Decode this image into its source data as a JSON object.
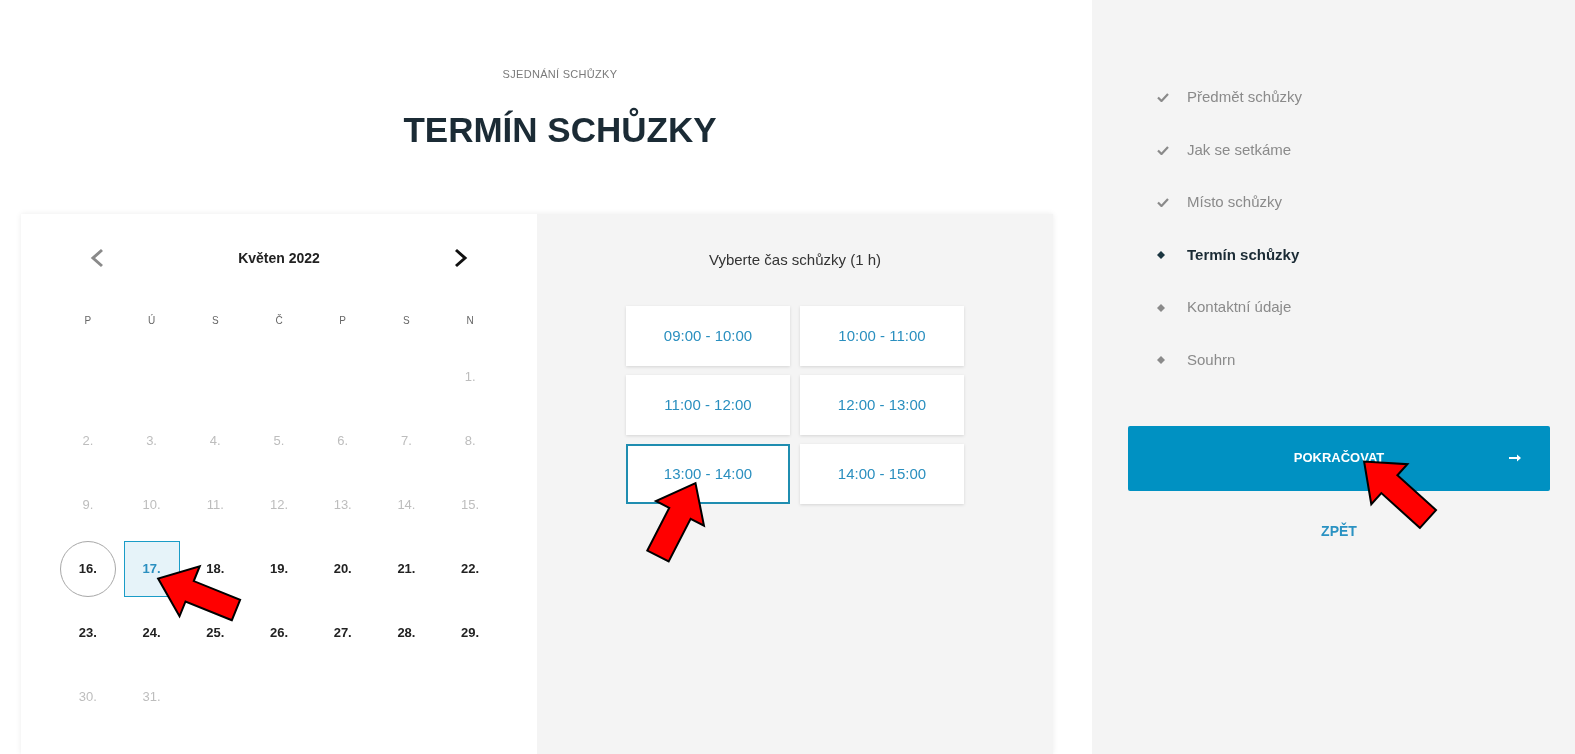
{
  "header": {
    "eyebrow": "SJEDNÁNÍ SCHŮZKY",
    "title": "TERMÍN SCHŮZKY"
  },
  "calendar": {
    "month": "Květen 2022",
    "prev": {
      "disabled": true
    },
    "next": {
      "disabled": false
    },
    "weekdays": [
      "P",
      "Ú",
      "S",
      "Č",
      "P",
      "S",
      "N"
    ],
    "weeks": [
      [
        {
          "label": "1.",
          "disabled": true,
          "today": false,
          "selected": false
        }
      ],
      [
        {
          "label": "2.",
          "disabled": true,
          "today": false,
          "selected": false
        },
        {
          "label": "3.",
          "disabled": true,
          "today": false,
          "selected": false
        },
        {
          "label": "4.",
          "disabled": true,
          "today": false,
          "selected": false
        },
        {
          "label": "5.",
          "disabled": true,
          "today": false,
          "selected": false
        },
        {
          "label": "6.",
          "disabled": true,
          "today": false,
          "selected": false
        },
        {
          "label": "7.",
          "disabled": true,
          "today": false,
          "selected": false
        },
        {
          "label": "8.",
          "disabled": true,
          "today": false,
          "selected": false
        }
      ],
      [
        {
          "label": "9.",
          "disabled": true,
          "today": false,
          "selected": false
        },
        {
          "label": "10.",
          "disabled": true,
          "today": false,
          "selected": false
        },
        {
          "label": "11.",
          "disabled": true,
          "today": false,
          "selected": false
        },
        {
          "label": "12.",
          "disabled": true,
          "today": false,
          "selected": false
        },
        {
          "label": "13.",
          "disabled": true,
          "today": false,
          "selected": false
        },
        {
          "label": "14.",
          "disabled": true,
          "today": false,
          "selected": false
        },
        {
          "label": "15.",
          "disabled": true,
          "today": false,
          "selected": false
        }
      ],
      [
        {
          "label": "16.",
          "disabled": false,
          "today": true,
          "selected": false
        },
        {
          "label": "17.",
          "disabled": false,
          "today": false,
          "selected": true
        },
        {
          "label": "18.",
          "disabled": false,
          "today": false,
          "selected": false
        },
        {
          "label": "19.",
          "disabled": false,
          "today": false,
          "selected": false
        },
        {
          "label": "20.",
          "disabled": false,
          "today": false,
          "selected": false
        },
        {
          "label": "21.",
          "disabled": false,
          "today": false,
          "selected": false
        },
        {
          "label": "22.",
          "disabled": false,
          "today": false,
          "selected": false
        }
      ],
      [
        {
          "label": "23.",
          "disabled": false,
          "today": false,
          "selected": false
        },
        {
          "label": "24.",
          "disabled": false,
          "today": false,
          "selected": false
        },
        {
          "label": "25.",
          "disabled": false,
          "today": false,
          "selected": false
        },
        {
          "label": "26.",
          "disabled": false,
          "today": false,
          "selected": false
        },
        {
          "label": "27.",
          "disabled": false,
          "today": false,
          "selected": false
        },
        {
          "label": "28.",
          "disabled": false,
          "today": false,
          "selected": false
        },
        {
          "label": "29.",
          "disabled": false,
          "today": false,
          "selected": false
        }
      ],
      [
        {
          "label": "30.",
          "disabled": true,
          "today": false,
          "selected": false
        },
        {
          "label": "31.",
          "disabled": true,
          "today": false,
          "selected": false
        }
      ]
    ]
  },
  "time_panel": {
    "heading": "Vyberte čas schůzky (1 h)",
    "slots": [
      {
        "label": "09:00 - 10:00",
        "selected": false
      },
      {
        "label": "10:00 - 11:00",
        "selected": false
      },
      {
        "label": "11:00 - 12:00",
        "selected": false
      },
      {
        "label": "12:00 - 13:00",
        "selected": false
      },
      {
        "label": "13:00 - 14:00",
        "selected": true
      },
      {
        "label": "14:00 - 15:00",
        "selected": false
      }
    ]
  },
  "steps": [
    {
      "label": "Předmět schůzky",
      "done": true,
      "current": false
    },
    {
      "label": "Jak se setkáme",
      "done": true,
      "current": false
    },
    {
      "label": "Místo schůzky",
      "done": true,
      "current": false
    },
    {
      "label": "Termín schůzky",
      "done": false,
      "current": true
    },
    {
      "label": "Kontaktní údaje",
      "done": false,
      "current": false
    },
    {
      "label": "Souhrn",
      "done": false,
      "current": false
    }
  ],
  "actions": {
    "continue": "POKRAČOVAT",
    "back": "ZPĚT"
  }
}
